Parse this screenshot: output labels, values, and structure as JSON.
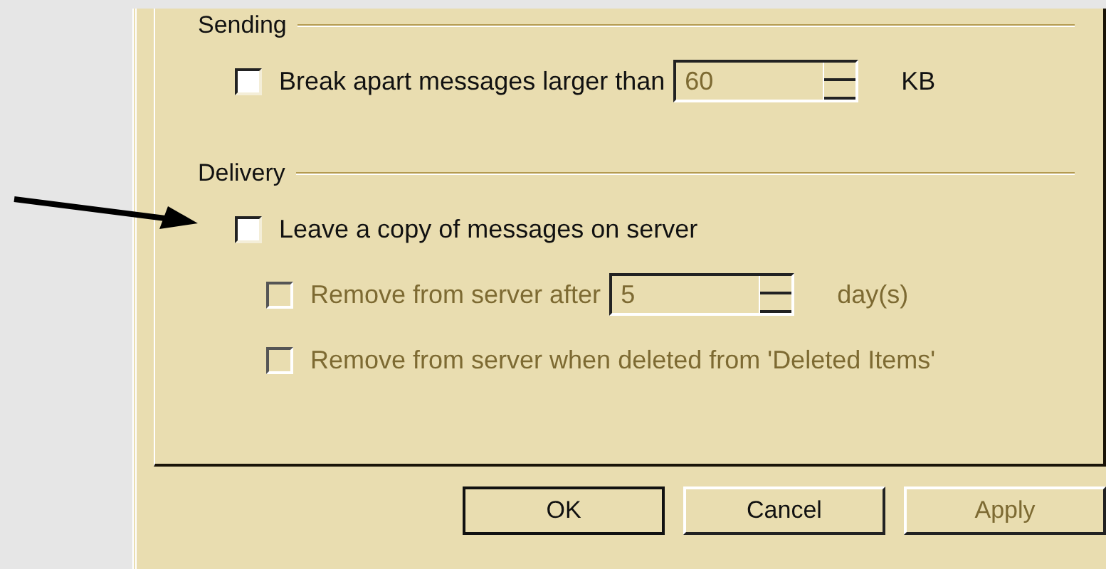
{
  "groups": [
    {
      "title": "Sending",
      "rows": [
        {
          "kind": "checkbox",
          "label": "Break apart messages larger than",
          "checked": false,
          "disabled": false,
          "spin": {
            "value": "60",
            "disabled": true
          },
          "unit": "KB"
        }
      ]
    },
    {
      "title": "Delivery",
      "rows": [
        {
          "kind": "checkbox",
          "label": "Leave a copy of messages on server",
          "checked": false,
          "disabled": false,
          "children": [
            {
              "kind": "checkbox",
              "label": "Remove from server after",
              "checked": false,
              "disabled": true,
              "spin": {
                "value": "5",
                "disabled": true
              },
              "unit": "day(s)"
            },
            {
              "kind": "checkbox",
              "label": "Remove from server when deleted from 'Deleted Items'",
              "checked": false,
              "disabled": true
            }
          ]
        }
      ]
    }
  ],
  "buttons": [
    {
      "label": "OK",
      "default": true,
      "disabled": false
    },
    {
      "label": "Cancel",
      "default": false,
      "disabled": false
    },
    {
      "label": "Apply",
      "default": false,
      "disabled": true
    }
  ]
}
